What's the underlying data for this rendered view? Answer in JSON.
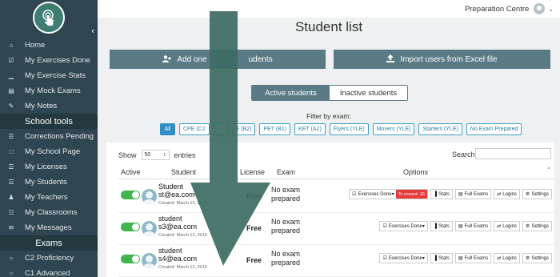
{
  "sidebar": {
    "items": [
      {
        "label": "Home",
        "icon": "home-icon",
        "glyph": "⌂"
      },
      {
        "label": "My Exercises Done",
        "icon": "checkbox-icon",
        "glyph": "☑"
      },
      {
        "label": "My Exercise Stats",
        "icon": "bar-chart-icon",
        "glyph": "▁"
      },
      {
        "label": "My Mock Exams",
        "icon": "document-icon",
        "glyph": "▤"
      },
      {
        "label": "My Notes",
        "icon": "edit-icon",
        "glyph": "✎"
      }
    ],
    "school_tools_heading": "School tools",
    "school_items": [
      {
        "label": "Corrections Pending",
        "icon": "list-icon",
        "glyph": "☰"
      },
      {
        "label": "My School Page",
        "icon": "page-icon",
        "glyph": "□"
      },
      {
        "label": "My Licenses",
        "icon": "license-icon",
        "glyph": "☰"
      },
      {
        "label": "My Students",
        "icon": "students-icon",
        "glyph": "☰"
      },
      {
        "label": "My Teachers",
        "icon": "teacher-icon",
        "glyph": "♟"
      },
      {
        "label": "My Classrooms",
        "icon": "classroom-icon",
        "glyph": "☷"
      },
      {
        "label": "My Messages",
        "icon": "message-icon",
        "glyph": "✉"
      }
    ],
    "exams_heading": "Exams",
    "exam_items": [
      {
        "label": "C2 Proficiency",
        "icon": "circle-icon",
        "glyph": "○"
      },
      {
        "label": "C1 Advanced",
        "icon": "circle-icon",
        "glyph": "○"
      }
    ],
    "collapse_glyph": "‹"
  },
  "topbar": {
    "user_label": "Preparation Centre",
    "chevron": "⌄"
  },
  "page_title": "Student list",
  "buttons": {
    "add_label": "Add one student",
    "add_visible_left": "Add one",
    "add_visible_right": "udents",
    "import_label": "Import users from Excel file"
  },
  "tabs": {
    "active": "Active students",
    "inactive": "Inactive students"
  },
  "filter": {
    "label": "Filter by exam:",
    "chips": [
      "All",
      "CPE (C2)",
      "CAE (C1)",
      "FCE (B2)",
      "PET (B1)",
      "KET (A2)",
      "Flyers (YLE)",
      "Movers (YLE)",
      "Starters (YLE)",
      "No Exam Prepared"
    ],
    "chip_visible": [
      "All",
      "CPE (C2",
      "",
      "E (B2)",
      "PET (B1)",
      "KET (A2)",
      "Flyers (YLE)",
      "Movers (YLE)",
      "Starters (YLE)",
      "No Exam Prepared"
    ]
  },
  "table_controls": {
    "show_label": "Show",
    "entries_value": "50",
    "entries_label": "entries",
    "search_label": "Search:"
  },
  "table": {
    "headers": {
      "active": "Active",
      "student": "Student",
      "license": "License",
      "exam": "Exam",
      "options": "Options"
    },
    "rows": [
      {
        "name": "Student",
        "email": "st@ea.com",
        "created": "Created: March 12, 2019",
        "license": "Free",
        "exam": "No exam prepared",
        "exercises_label": "Exercises Done",
        "badge": "To correct: 16"
      },
      {
        "name": "student",
        "email": "s3@ea.com",
        "created": "Created: March 12, 2019",
        "license": "Free",
        "exam": "No exam prepared",
        "exercises_label": "Exercises Done",
        "badge": ""
      },
      {
        "name": "student",
        "email": "s4@ea.com",
        "created": "Created: March 12, 2019",
        "license": "Free",
        "exam": "No exam prepared",
        "exercises_label": "Exercises Done",
        "badge": ""
      }
    ],
    "option_labels": {
      "stats": "Stats",
      "full_exams": "Full Exams",
      "logins": "Logins",
      "settings": "Settings"
    }
  },
  "colors": {
    "sidebar": "#2f4650",
    "accent": "#5a7b85",
    "arrow": "#3d6b63",
    "toggle_on": "#3fb54c",
    "badge": "#e53b3b"
  }
}
